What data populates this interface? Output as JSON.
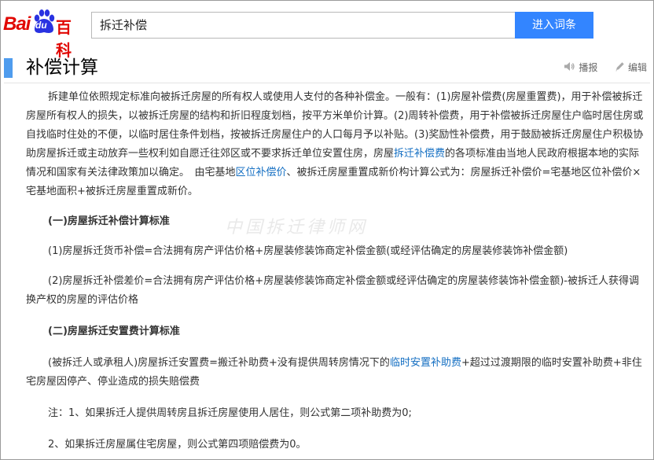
{
  "header": {
    "logo_bai": "Bai",
    "logo_du": "du",
    "logo_baike": "百科",
    "search_value": "拆迁补偿",
    "search_button": "进入词条"
  },
  "section": {
    "title": "补偿计算",
    "broadcast_label": "播报",
    "edit_label": "编辑"
  },
  "watermark": "中国拆迁律师网",
  "content": {
    "p1_a": "拆建单位依照规定标准向被拆迁房屋的所有权人或使用人支付的各种补偿金。一般有：(1)房屋补偿费(房屋重置费)，用于补偿被拆迁房屋所有权人的损失，以被拆迁房屋的结构和折旧程度划档，按平方米单价计算。(2)周转补偿费，用于补偿被拆迁房屋住户临时居住房或自找临时住处的不便，以临时居住条件划档，按被拆迁房屋住户的人口每月予以补贴。(3)奖励性补偿费，用于鼓励被拆迁房屋住户积极协助房屋拆迁或主动放弃一些权利如自愿迁往郊区或不要求拆迁单位安置住房，房屋",
    "p1_link1": "拆迁补偿费",
    "p1_b": "的各项标准由当地人民政府根据本地的实际情况和国家有关法律政策加以确定。　由宅基地",
    "p1_link2": "区位补偿价",
    "p1_c": "、被拆迁房屋重置成新价构计算公式为：房屋拆迁补偿价=宅基地区位补偿价×宅基地面积+被拆迁房屋重置成新价。",
    "h1": "(一)房屋拆迁补偿计算标准",
    "p2": "(1)房屋拆迁货币补偿=合法拥有房产评估价格+房屋装修装饰商定补偿金额(或经评估确定的房屋装修装饰补偿金额)",
    "p3": "(2)房屋拆迁补偿差价=合法拥有房产评估价格+房屋装修装饰商定补偿金额或经评估确定的房屋装修装饰补偿金额)-被拆迁人获得调换产权的房屋的评估价格",
    "h2": "(二)房屋拆迁安置费计算标准",
    "p4_a": "(被拆迁人或承租人)房屋拆迁安置费=搬迁补助费+没有提供周转房情况下的",
    "p4_link": "临时安置补助费",
    "p4_b": "+超过过渡期限的临时安置补助费+非住宅房屋因停产、停业造成的损失赔偿费",
    "note1": "注：1、如果拆迁人提供周转房且拆迁房屋使用人居住，则公式第二项补助费为0;",
    "note2": "2、如果拆迁房屋属住宅房屋，则公式第四项赔偿费为0。"
  },
  "colors": {
    "brand_red": "#e10601",
    "brand_blue": "#2932e1",
    "button_blue": "#3385ff",
    "link_blue": "#136ec2",
    "section_bar": "#4f9cee"
  },
  "icons": {
    "broadcast": "speaker-icon",
    "edit": "pencil-icon"
  }
}
